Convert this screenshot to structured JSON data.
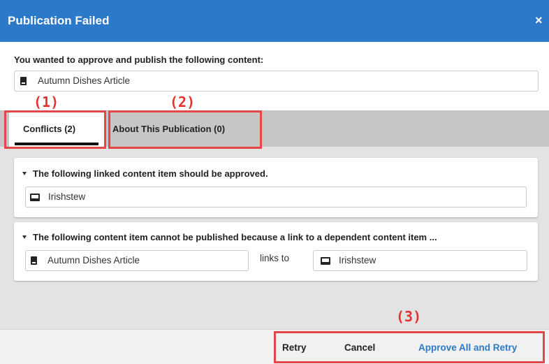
{
  "dialog": {
    "title": "Publication Failed",
    "close_glyph": "×",
    "accent_color": "#2c78c9"
  },
  "prompt": "You wanted to approve and publish the following content:",
  "content_item": {
    "label": "Autumn Dishes Article",
    "icon": "document-icon"
  },
  "annotations": {
    "one": "(1)",
    "two": "(2)",
    "three": "(3)",
    "color": "#e4332e"
  },
  "tabs": [
    {
      "label": "Conflicts (2)",
      "active": true
    },
    {
      "label": "About This Publication (0)",
      "active": false
    }
  ],
  "conflicts": [
    {
      "heading": "The following linked content item should be approved.",
      "items": [
        {
          "label": "Irishstew",
          "icon": "image-icon"
        }
      ]
    },
    {
      "heading": "The following content item cannot be published because a link to a dependent content item ...",
      "source": {
        "label": "Autumn Dishes Article",
        "icon": "document-icon"
      },
      "relation": "links to",
      "target": {
        "label": "Irishstew",
        "icon": "image-icon"
      }
    }
  ],
  "footer": {
    "retry": "Retry",
    "cancel": "Cancel",
    "approve_all": "Approve All and Retry",
    "approve_color": "#2c78c9"
  }
}
